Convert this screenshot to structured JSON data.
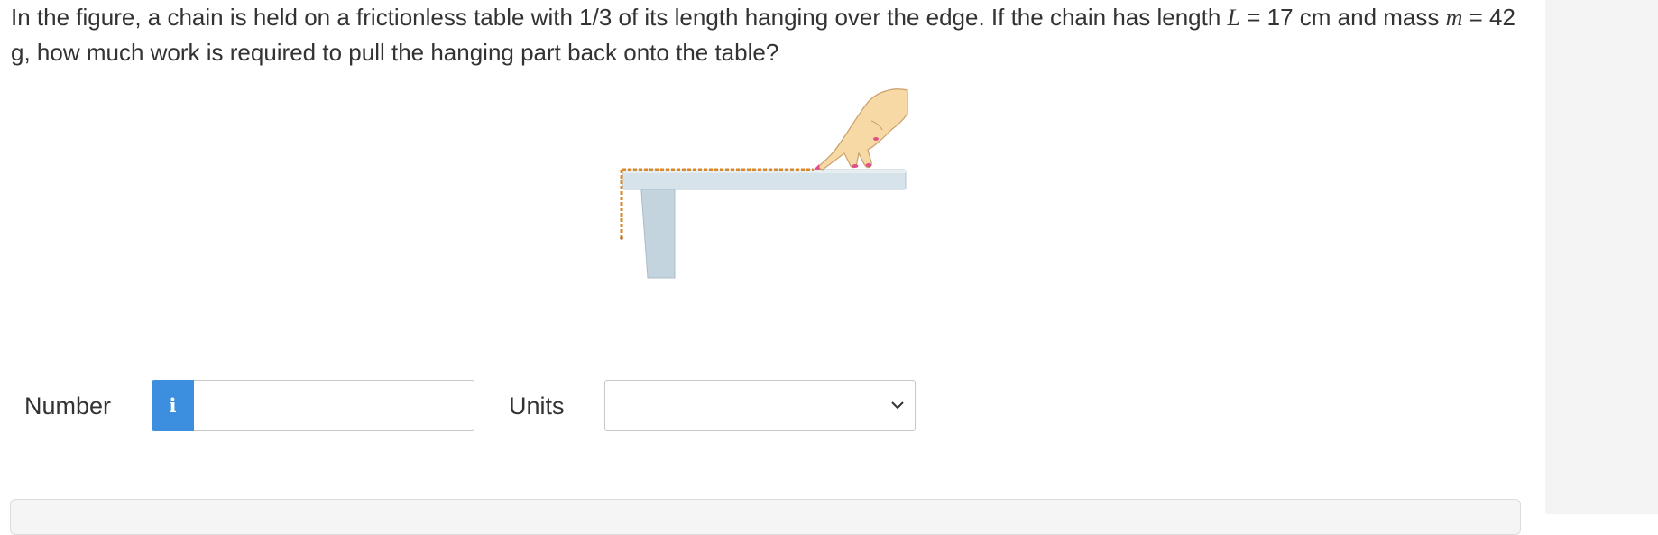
{
  "question": {
    "intro": "In the figure, a chain is held on a frictionless table with 1/3 of its length hanging over the edge. If the chain has length ",
    "length_symbol": "L",
    "length_value": " = 17 cm and mass ",
    "mass_symbol": "m",
    "mass_value": " = 42 g, how much work is required to pull the hanging part back onto the table?"
  },
  "figure": {
    "icons": [
      "table-icon",
      "chain-icon",
      "hand-icon"
    ],
    "colors": {
      "table": "#cfdde5",
      "table_edge": "#a9bcc8",
      "chain": "#d9892a",
      "hand_skin": "#f7d9a6",
      "hand_outline": "#c9a06a",
      "nails": "#e0508a"
    }
  },
  "answer": {
    "number_label": "Number",
    "number_value": "",
    "info_icon": "info-icon",
    "units_label": "Units",
    "units_selected": "",
    "units_icon": "chevron-down-icon"
  },
  "colors": {
    "info_button": "#3c8fdf",
    "text": "#333333",
    "gutter": "#f4f4f4"
  }
}
